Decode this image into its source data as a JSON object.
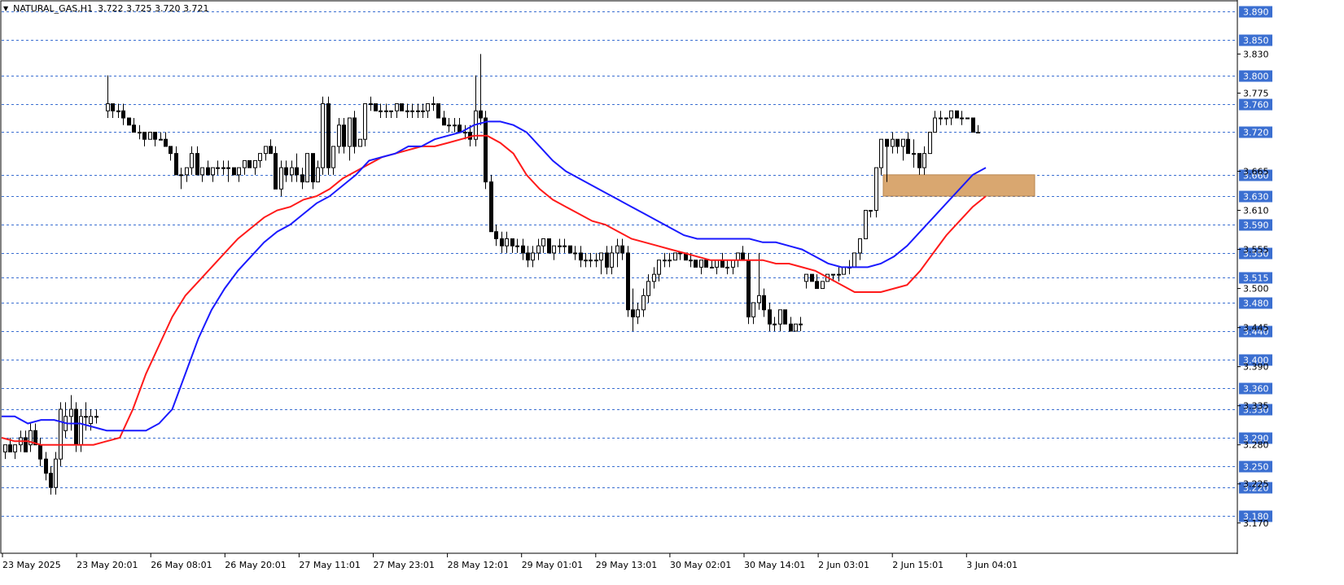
{
  "header": {
    "symbol": "NATURAL_GAS,H1",
    "ohlc": "3.722 3.725 3.720 3.721"
  },
  "colors": {
    "bull_body": "#ffffff",
    "bear_body": "#000000",
    "wick": "#000000",
    "ma_fast": "#1a1aff",
    "ma_slow": "#ff1a1a",
    "zone_fill": "#d9a770",
    "grid_badge": "#3b6fd1"
  },
  "chart_data": {
    "type": "candlestick",
    "title": "",
    "ylim": [
      3.16,
      3.9
    ],
    "grid_levels": [
      "3.890",
      "3.850",
      "3.800",
      "3.760",
      "3.720",
      "3.660",
      "3.630",
      "3.590",
      "3.550",
      "3.515",
      "3.480",
      "3.440",
      "3.400",
      "3.360",
      "3.330",
      "3.290",
      "3.250",
      "3.220",
      "3.180"
    ],
    "plain_ticks": [
      "3.830",
      "3.775",
      "3.665",
      "3.610",
      "3.555",
      "3.500",
      "3.445",
      "3.390",
      "3.335",
      "3.280",
      "3.225",
      "3.170"
    ],
    "x_labels": [
      "23 May 2025",
      "23 May 20:01",
      "26 May 08:01",
      "26 May 20:01",
      "27 May 11:01",
      "27 May 23:01",
      "28 May 12:01",
      "29 May 01:01",
      "29 May 13:01",
      "30 May 02:01",
      "30 May 14:01",
      "2 Jun 03:01",
      "2 Jun 15:01",
      "3 Jun 04:01"
    ],
    "candles": [
      [
        3.27,
        3.28,
        3.26,
        3.28
      ],
      [
        3.28,
        3.29,
        3.27,
        3.27
      ],
      [
        3.27,
        3.28,
        3.26,
        3.28
      ],
      [
        3.28,
        3.3,
        3.27,
        3.29
      ],
      [
        3.29,
        3.3,
        3.27,
        3.27
      ],
      [
        3.28,
        3.31,
        3.27,
        3.3
      ],
      [
        3.3,
        3.31,
        3.28,
        3.28
      ],
      [
        3.28,
        3.29,
        3.25,
        3.26
      ],
      [
        3.26,
        3.27,
        3.23,
        3.24
      ],
      [
        3.24,
        3.25,
        3.21,
        3.22
      ],
      [
        3.22,
        3.27,
        3.21,
        3.26
      ],
      [
        3.26,
        3.34,
        3.25,
        3.33
      ],
      [
        3.3,
        3.34,
        3.29,
        3.32
      ],
      [
        3.32,
        3.35,
        3.3,
        3.33
      ],
      [
        3.33,
        3.34,
        3.27,
        3.28
      ],
      [
        3.28,
        3.33,
        3.27,
        3.32
      ],
      [
        3.32,
        3.34,
        3.3,
        3.32
      ],
      [
        3.31,
        3.33,
        3.3,
        3.32
      ],
      [
        3.32,
        3.33,
        3.31,
        3.32
      ],
      [
        3.75,
        3.8,
        3.74,
        3.76
      ],
      [
        3.76,
        3.76,
        3.74,
        3.75
      ],
      [
        3.75,
        3.76,
        3.74,
        3.75
      ],
      [
        3.75,
        3.76,
        3.73,
        3.74
      ],
      [
        3.74,
        3.74,
        3.73,
        3.73
      ],
      [
        3.73,
        3.74,
        3.72,
        3.72
      ],
      [
        3.72,
        3.73,
        3.71,
        3.72
      ],
      [
        3.72,
        3.72,
        3.7,
        3.71
      ],
      [
        3.71,
        3.72,
        3.71,
        3.72
      ],
      [
        3.72,
        3.72,
        3.7,
        3.71
      ],
      [
        3.71,
        3.72,
        3.71,
        3.71
      ],
      [
        3.71,
        3.72,
        3.7,
        3.7
      ],
      [
        3.7,
        3.7,
        3.68,
        3.69
      ],
      [
        3.69,
        3.7,
        3.66,
        3.66
      ],
      [
        3.66,
        3.67,
        3.64,
        3.66
      ],
      [
        3.66,
        3.67,
        3.65,
        3.67
      ],
      [
        3.67,
        3.7,
        3.66,
        3.69
      ],
      [
        3.69,
        3.7,
        3.66,
        3.66
      ],
      [
        3.66,
        3.67,
        3.65,
        3.67
      ],
      [
        3.67,
        3.68,
        3.66,
        3.66
      ],
      [
        3.66,
        3.67,
        3.65,
        3.67
      ],
      [
        3.67,
        3.68,
        3.66,
        3.67
      ],
      [
        3.67,
        3.68,
        3.66,
        3.67
      ],
      [
        3.67,
        3.68,
        3.65,
        3.67
      ],
      [
        3.67,
        3.67,
        3.66,
        3.66
      ],
      [
        3.66,
        3.67,
        3.65,
        3.67
      ],
      [
        3.67,
        3.68,
        3.66,
        3.68
      ],
      [
        3.68,
        3.68,
        3.67,
        3.67
      ],
      [
        3.67,
        3.68,
        3.66,
        3.68
      ],
      [
        3.68,
        3.69,
        3.67,
        3.69
      ],
      [
        3.69,
        3.7,
        3.68,
        3.7
      ],
      [
        3.7,
        3.71,
        3.69,
        3.69
      ],
      [
        3.69,
        3.7,
        3.64,
        3.64
      ],
      [
        3.64,
        3.68,
        3.63,
        3.67
      ],
      [
        3.67,
        3.68,
        3.65,
        3.66
      ],
      [
        3.66,
        3.68,
        3.65,
        3.67
      ],
      [
        3.67,
        3.69,
        3.65,
        3.66
      ],
      [
        3.66,
        3.67,
        3.64,
        3.65
      ],
      [
        3.65,
        3.69,
        3.65,
        3.69
      ],
      [
        3.69,
        3.69,
        3.64,
        3.65
      ],
      [
        3.65,
        3.68,
        3.65,
        3.67
      ],
      [
        3.67,
        3.77,
        3.66,
        3.76
      ],
      [
        3.76,
        3.77,
        3.66,
        3.67
      ],
      [
        3.67,
        3.7,
        3.66,
        3.7
      ],
      [
        3.7,
        3.74,
        3.69,
        3.73
      ],
      [
        3.73,
        3.74,
        3.69,
        3.7
      ],
      [
        3.7,
        3.74,
        3.68,
        3.74
      ],
      [
        3.74,
        3.75,
        3.69,
        3.7
      ],
      [
        3.7,
        3.71,
        3.7,
        3.71
      ],
      [
        3.71,
        3.76,
        3.7,
        3.76
      ],
      [
        3.76,
        3.77,
        3.75,
        3.76
      ],
      [
        3.76,
        3.76,
        3.75,
        3.75
      ],
      [
        3.75,
        3.76,
        3.74,
        3.75
      ],
      [
        3.75,
        3.76,
        3.74,
        3.75
      ],
      [
        3.75,
        3.75,
        3.74,
        3.75
      ],
      [
        3.75,
        3.76,
        3.74,
        3.76
      ],
      [
        3.76,
        3.76,
        3.75,
        3.75
      ],
      [
        3.75,
        3.76,
        3.74,
        3.75
      ],
      [
        3.75,
        3.76,
        3.74,
        3.75
      ],
      [
        3.75,
        3.76,
        3.74,
        3.75
      ],
      [
        3.75,
        3.76,
        3.74,
        3.75
      ],
      [
        3.75,
        3.76,
        3.74,
        3.76
      ],
      [
        3.76,
        3.77,
        3.75,
        3.76
      ],
      [
        3.76,
        3.76,
        3.74,
        3.74
      ],
      [
        3.74,
        3.75,
        3.73,
        3.73
      ],
      [
        3.73,
        3.74,
        3.72,
        3.73
      ],
      [
        3.73,
        3.74,
        3.72,
        3.73
      ],
      [
        3.73,
        3.74,
        3.72,
        3.72
      ],
      [
        3.72,
        3.73,
        3.71,
        3.72
      ],
      [
        3.72,
        3.73,
        3.7,
        3.71
      ],
      [
        3.71,
        3.8,
        3.7,
        3.75
      ],
      [
        3.75,
        3.83,
        3.73,
        3.74
      ],
      [
        3.74,
        3.75,
        3.64,
        3.65
      ],
      [
        3.65,
        3.66,
        3.58,
        3.58
      ],
      [
        3.58,
        3.59,
        3.56,
        3.57
      ],
      [
        3.57,
        3.58,
        3.55,
        3.56
      ],
      [
        3.56,
        3.58,
        3.55,
        3.57
      ],
      [
        3.57,
        3.57,
        3.55,
        3.56
      ],
      [
        3.56,
        3.57,
        3.55,
        3.56
      ],
      [
        3.56,
        3.57,
        3.54,
        3.55
      ],
      [
        3.55,
        3.56,
        3.53,
        3.54
      ],
      [
        3.54,
        3.56,
        3.53,
        3.55
      ],
      [
        3.55,
        3.57,
        3.54,
        3.56
      ],
      [
        3.56,
        3.57,
        3.55,
        3.57
      ],
      [
        3.57,
        3.57,
        3.55,
        3.55
      ],
      [
        3.55,
        3.56,
        3.54,
        3.56
      ],
      [
        3.56,
        3.57,
        3.55,
        3.56
      ],
      [
        3.56,
        3.57,
        3.55,
        3.56
      ],
      [
        3.56,
        3.56,
        3.55,
        3.55
      ],
      [
        3.55,
        3.56,
        3.54,
        3.55
      ],
      [
        3.55,
        3.56,
        3.53,
        3.54
      ],
      [
        3.54,
        3.55,
        3.53,
        3.54
      ],
      [
        3.54,
        3.55,
        3.53,
        3.54
      ],
      [
        3.54,
        3.55,
        3.53,
        3.54
      ],
      [
        3.54,
        3.55,
        3.52,
        3.55
      ],
      [
        3.55,
        3.56,
        3.52,
        3.53
      ],
      [
        3.53,
        3.56,
        3.52,
        3.55
      ],
      [
        3.55,
        3.57,
        3.53,
        3.56
      ],
      [
        3.56,
        3.57,
        3.54,
        3.55
      ],
      [
        3.55,
        3.56,
        3.46,
        3.47
      ],
      [
        3.47,
        3.5,
        3.44,
        3.46
      ],
      [
        3.46,
        3.48,
        3.45,
        3.47
      ],
      [
        3.47,
        3.5,
        3.46,
        3.49
      ],
      [
        3.49,
        3.52,
        3.48,
        3.51
      ],
      [
        3.51,
        3.53,
        3.5,
        3.52
      ],
      [
        3.52,
        3.54,
        3.51,
        3.54
      ],
      [
        3.54,
        3.55,
        3.53,
        3.54
      ],
      [
        3.54,
        3.55,
        3.53,
        3.54
      ],
      [
        3.54,
        3.55,
        3.54,
        3.55
      ],
      [
        3.55,
        3.55,
        3.54,
        3.55
      ],
      [
        3.55,
        3.55,
        3.54,
        3.54
      ],
      [
        3.54,
        3.55,
        3.53,
        3.54
      ],
      [
        3.54,
        3.54,
        3.53,
        3.53
      ],
      [
        3.53,
        3.54,
        3.52,
        3.54
      ],
      [
        3.54,
        3.54,
        3.53,
        3.53
      ],
      [
        3.53,
        3.54,
        3.53,
        3.53
      ],
      [
        3.53,
        3.54,
        3.52,
        3.54
      ],
      [
        3.54,
        3.55,
        3.53,
        3.53
      ],
      [
        3.53,
        3.54,
        3.52,
        3.53
      ],
      [
        3.53,
        3.54,
        3.52,
        3.54
      ],
      [
        3.54,
        3.55,
        3.53,
        3.55
      ],
      [
        3.55,
        3.56,
        3.54,
        3.54
      ],
      [
        3.54,
        3.55,
        3.45,
        3.46
      ],
      [
        3.46,
        3.48,
        3.45,
        3.48
      ],
      [
        3.48,
        3.55,
        3.47,
        3.49
      ],
      [
        3.49,
        3.5,
        3.46,
        3.47
      ],
      [
        3.47,
        3.48,
        3.44,
        3.45
      ],
      [
        3.45,
        3.46,
        3.44,
        3.45
      ],
      [
        3.45,
        3.47,
        3.44,
        3.47
      ],
      [
        3.47,
        3.47,
        3.45,
        3.45
      ],
      [
        3.45,
        3.46,
        3.44,
        3.44
      ],
      [
        3.44,
        3.45,
        3.44,
        3.45
      ],
      [
        3.45,
        3.46,
        3.44,
        3.45
      ],
      [
        3.51,
        3.52,
        3.5,
        3.52
      ],
      [
        3.52,
        3.52,
        3.51,
        3.51
      ],
      [
        3.51,
        3.52,
        3.5,
        3.5
      ],
      [
        3.5,
        3.51,
        3.5,
        3.51
      ],
      [
        3.51,
        3.52,
        3.51,
        3.52
      ],
      [
        3.52,
        3.52,
        3.51,
        3.52
      ],
      [
        3.52,
        3.53,
        3.51,
        3.52
      ],
      [
        3.52,
        3.53,
        3.52,
        3.53
      ],
      [
        3.53,
        3.54,
        3.52,
        3.53
      ],
      [
        3.53,
        3.55,
        3.53,
        3.55
      ],
      [
        3.55,
        3.57,
        3.54,
        3.57
      ],
      [
        3.57,
        3.61,
        3.57,
        3.61
      ],
      [
        3.61,
        3.61,
        3.6,
        3.61
      ],
      [
        3.61,
        3.67,
        3.6,
        3.67
      ],
      [
        3.67,
        3.71,
        3.66,
        3.71
      ],
      [
        3.71,
        3.71,
        3.65,
        3.7
      ],
      [
        3.7,
        3.72,
        3.69,
        3.71
      ],
      [
        3.71,
        3.71,
        3.69,
        3.7
      ],
      [
        3.7,
        3.71,
        3.68,
        3.71
      ],
      [
        3.71,
        3.72,
        3.69,
        3.69
      ],
      [
        3.69,
        3.71,
        3.67,
        3.69
      ],
      [
        3.69,
        3.69,
        3.66,
        3.67
      ],
      [
        3.67,
        3.7,
        3.66,
        3.69
      ],
      [
        3.69,
        3.72,
        3.69,
        3.72
      ],
      [
        3.72,
        3.75,
        3.72,
        3.74
      ],
      [
        3.74,
        3.75,
        3.73,
        3.74
      ],
      [
        3.74,
        3.74,
        3.73,
        3.74
      ],
      [
        3.74,
        3.75,
        3.73,
        3.75
      ],
      [
        3.75,
        3.75,
        3.74,
        3.74
      ],
      [
        3.74,
        3.75,
        3.73,
        3.74
      ],
      [
        3.74,
        3.74,
        3.74,
        3.74
      ],
      [
        3.74,
        3.74,
        3.72,
        3.72
      ],
      [
        3.72,
        3.73,
        3.72,
        3.72
      ]
    ],
    "ma_fast": [
      3.32,
      3.32,
      3.31,
      3.315,
      3.315,
      3.31,
      3.31,
      3.305,
      3.3,
      3.3,
      3.3,
      3.3,
      3.31,
      3.33,
      3.38,
      3.43,
      3.47,
      3.5,
      3.525,
      3.545,
      3.565,
      3.58,
      3.59,
      3.605,
      3.62,
      3.63,
      3.645,
      3.66,
      3.68,
      3.685,
      3.69,
      3.7,
      3.7,
      3.71,
      3.715,
      3.72,
      3.73,
      3.735,
      3.735,
      3.73,
      3.72,
      3.7,
      3.68,
      3.665,
      3.655,
      3.645,
      3.635,
      3.625,
      3.615,
      3.605,
      3.595,
      3.585,
      3.575,
      3.57,
      3.57,
      3.57,
      3.57,
      3.57,
      3.565,
      3.565,
      3.56,
      3.555,
      3.545,
      3.535,
      3.53,
      3.53,
      3.53,
      3.535,
      3.545,
      3.56,
      3.58,
      3.6,
      3.62,
      3.64,
      3.66,
      3.67
    ],
    "ma_slow": [
      3.29,
      3.285,
      3.285,
      3.28,
      3.28,
      3.28,
      3.28,
      3.28,
      3.285,
      3.29,
      3.33,
      3.38,
      3.42,
      3.46,
      3.49,
      3.51,
      3.53,
      3.55,
      3.57,
      3.585,
      3.6,
      3.61,
      3.615,
      3.625,
      3.63,
      3.64,
      3.655,
      3.665,
      3.675,
      3.685,
      3.69,
      3.695,
      3.7,
      3.7,
      3.705,
      3.71,
      3.715,
      3.715,
      3.705,
      3.69,
      3.66,
      3.64,
      3.625,
      3.615,
      3.605,
      3.595,
      3.59,
      3.58,
      3.57,
      3.565,
      3.56,
      3.555,
      3.55,
      3.545,
      3.54,
      3.54,
      3.54,
      3.54,
      3.54,
      3.535,
      3.535,
      3.53,
      3.525,
      3.515,
      3.505,
      3.495,
      3.495,
      3.495,
      3.5,
      3.505,
      3.525,
      3.55,
      3.575,
      3.595,
      3.615,
      3.63
    ],
    "zone": {
      "low": 3.63,
      "high": 3.66
    }
  }
}
